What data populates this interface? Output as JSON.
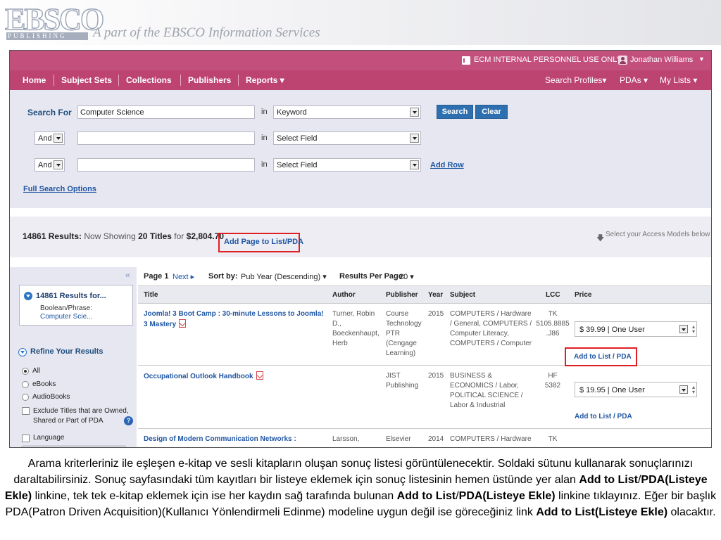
{
  "slide": {
    "logo_main": "EBSCO",
    "logo_sub": "PUBLISHING",
    "tagline": "A part of the EBSCO Information Services"
  },
  "app": {
    "user_bar": {
      "internal": "ECM INTERNAL PERSONNEL USE ONLY",
      "user_name": "Jonathan Williams",
      "caret": "▼"
    },
    "nav": {
      "home": "Home",
      "subject_sets": "Subject Sets",
      "collections": "Collections",
      "publishers": "Publishers",
      "reports": "Reports ▾",
      "search_profiles": "Search Profiles▾",
      "pdas": "PDAs ▾",
      "my_lists": "My Lists ▾"
    },
    "search": {
      "search_for_label": "Search For",
      "row1_value": "Computer Science",
      "in_label": "in",
      "row1_field": "Keyword",
      "search_btn": "Search",
      "clear_btn": "Clear",
      "row2_bool": "And",
      "row2_field": "Select Field",
      "row3_bool": "And",
      "row3_field": "Select Field",
      "add_row": "Add Row",
      "full_options": "Full Search Options"
    },
    "results_summary": {
      "count": "14861 Results:",
      "showing_prefix": "Now Showing",
      "title_count": "20",
      "titles_word": "Titles",
      "for_word": "for",
      "total": "$2,804.70",
      "add_page_link": "Add Page to List/PDA",
      "access_note": "Select your Access Models below",
      "access_icon": "🡇"
    },
    "sidebar": {
      "collapse": "«",
      "results_for_title": "14861 Results for...",
      "boolean_label": "Boolean/Phrase:",
      "boolean_value": "Computer Scie...",
      "refine_title": "Refine Your Results",
      "options": [
        "All",
        "eBooks",
        "AudioBooks"
      ],
      "exclude_text": "Exclude Titles that are Owned, Shared or Part of PDA",
      "help": "?",
      "language": "Language"
    },
    "toolbar": {
      "page": "Page 1",
      "next": "Next ▸",
      "sort_label": "Sort by:",
      "sort_value": "Pub Year (Descending) ▾",
      "per_page_label": "Results Per Page:",
      "per_page_value": "20 ▾"
    },
    "table": {
      "columns": [
        "Title",
        "Author",
        "Publisher",
        "Year",
        "Subject",
        "LCC",
        "Price"
      ],
      "rows": [
        {
          "title_l1": "Joomla! 3 Boot Camp : 30-minute Lessons to Joomla!",
          "title_l2": "3 Mastery",
          "author": [
            "Turner, Robin",
            "D.,",
            "Boeckenhaupt,",
            "Herb"
          ],
          "publisher": [
            "Course",
            "Technology",
            "PTR",
            "(Cengage",
            "Learning)"
          ],
          "year": "2015",
          "subject": [
            "COMPUTERS / Hardware",
            "/ General, COMPUTERS /",
            "Computer Literacy,",
            "COMPUTERS / Computer"
          ],
          "lcc": [
            "TK",
            "5105.8885",
            ".J86"
          ],
          "price": "$ 39.99 | One User",
          "add_link": "Add to List / PDA"
        },
        {
          "title_l1": "Occupational Outlook Handbook",
          "title_l2": "",
          "author": [],
          "publisher": [
            "JIST",
            "Publishing"
          ],
          "year": "2015",
          "subject": [
            "BUSINESS &",
            "ECONOMICS / Labor,",
            "POLITICAL SCIENCE /",
            "Labor & Industrial"
          ],
          "lcc": [
            "HF",
            "5382"
          ],
          "price": "$ 19.95 | One User",
          "add_link": "Add to List / PDA"
        },
        {
          "title_l1": "Design of Modern Communication Networks :",
          "title_l2": "",
          "author": [
            "Larsson,"
          ],
          "publisher": [
            "Elsevier"
          ],
          "year": "2014",
          "subject": [
            "COMPUTERS / Hardware"
          ],
          "lcc": [
            "TK"
          ],
          "price": "",
          "add_link": ""
        }
      ]
    }
  },
  "caption": {
    "p1": "Arama kriterleriniz ile eşleşen e-kitap ve sesli kitapların oluşan sonuç listesi görüntülenecektir. Soldaki sütunu kullanarak sonuçlarınızı daraltabilirsiniz. Sonuç sayfasındaki tüm kayıtları bir listeye eklemek için sonuç listesinin hemen üstünde yer alan",
    "b1": "Add to List",
    "s1": "/",
    "b2": "PDA(Listeye Ekle)",
    "p2": "linkine, tek tek e-kitap eklemek için ise her kaydın sağ tarafında bulunan",
    "b3": "Add to List",
    "s2": "/",
    "b4": "PDA(Listeye Ekle)",
    "p3": "linkine tıklayınız. Eğer bir başlık PDA(Patron Driven Acquisition)(Kullanıcı Yönlendirmeli Edinme) modeline uygun değil ise göreceğiniz link",
    "b5": "Add to List(Listeye Ekle)",
    "p4": "olacaktır."
  }
}
